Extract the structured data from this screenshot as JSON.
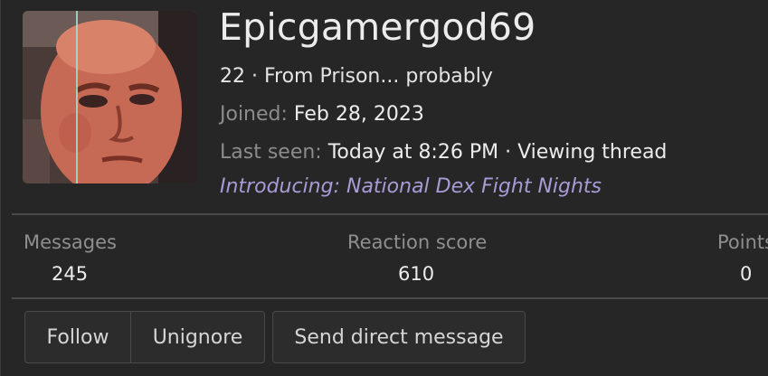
{
  "profile": {
    "username": "Epicgamergod69",
    "age_location": "22 · From Prison... probably",
    "joined_label": "Joined:",
    "joined_value": "Feb 28, 2023",
    "last_seen_label": "Last seen:",
    "last_seen_value": "Today at 8:26 PM · Viewing thread",
    "custom_title": "Introducing: National Dex Fight Nights"
  },
  "stats": [
    {
      "label": "Messages",
      "value": "245"
    },
    {
      "label": "Reaction score",
      "value": "610"
    },
    {
      "label": "Points",
      "value": "0"
    }
  ],
  "actions": {
    "follow": "Follow",
    "unignore": "Unignore",
    "send_dm": "Send direct message"
  },
  "colors": {
    "background": "#262626",
    "custom_title": "#a99bd6",
    "muted_text": "#8c8c8c",
    "divider": "#4a4a4a"
  }
}
